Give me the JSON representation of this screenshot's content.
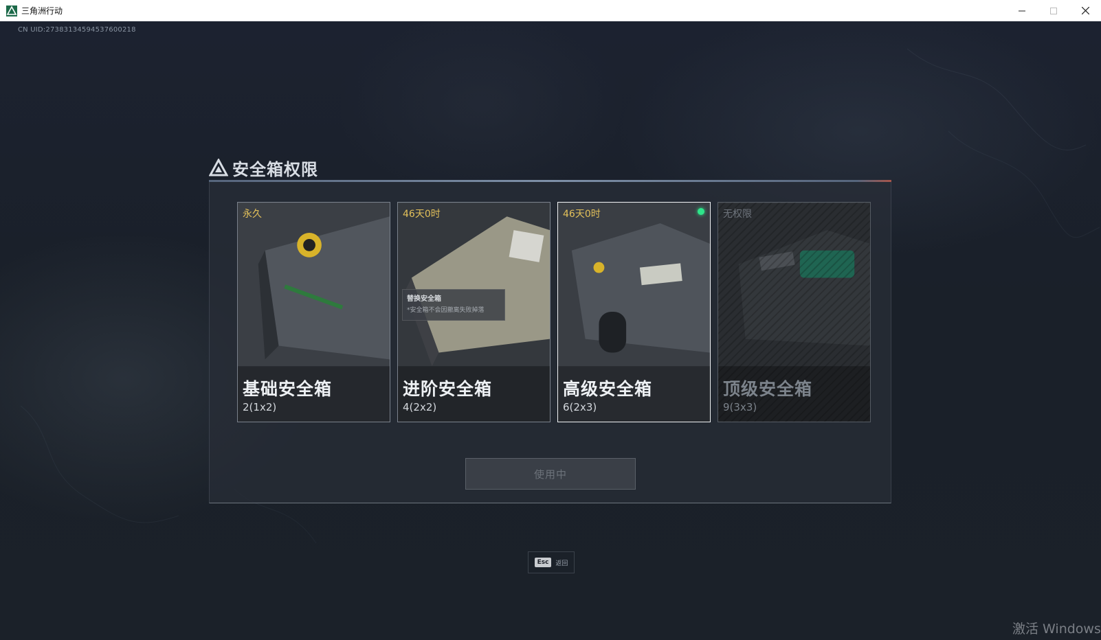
{
  "window": {
    "title": "三角洲行动",
    "minimize_icon": "minimize-icon",
    "maximize_icon": "maximize-icon",
    "close_icon": "close-icon"
  },
  "uid": "CN UID:2738313459453760021​8",
  "panel": {
    "title": "安全箱权限",
    "title_icon": "delta-triangle-icon",
    "cards": [
      {
        "time": "永久",
        "name": "基础安全箱",
        "size": "2(1x2)",
        "state": "owned"
      },
      {
        "time": "46天0时",
        "name": "进阶安全箱",
        "size": "4(2x2)",
        "state": "owned",
        "tooltip_title": "替换安全箱",
        "tooltip_desc": "*安全箱不会因撤离失败掉落"
      },
      {
        "time": "46天0时",
        "name": "高级安全箱",
        "size": "6(2x3)",
        "state": "equipped"
      },
      {
        "time": "无权限",
        "name": "顶级安全箱",
        "size": "9(3x3)",
        "state": "locked"
      }
    ],
    "use_button_label": "使用中"
  },
  "esc_hint": {
    "key": "Esc",
    "label": "返回"
  },
  "watermark": "激活 Windows",
  "colors": {
    "accent_gold": "#e3c05a",
    "equipped_green": "#2ee58a",
    "background": "#1b2029"
  }
}
